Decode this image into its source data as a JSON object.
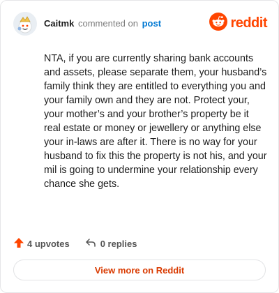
{
  "header": {
    "author": "Caitmk",
    "commented_text": "commented on",
    "post_link": "post",
    "brand": "reddit",
    "brand_color": "#ff4500",
    "link_color": "#0079d3"
  },
  "comment": {
    "body": "NTA, if you are currently sharing bank accounts and assets, please separate them, your husband’s family think they are entitled to everything you and your family own and they are not. Protect your, your mother’s and your brother’s property be it real estate or money or jewellery or anything else your in-laws are after it. There is no way for your husband to fix this the property is not his, and your mil is going to undermine your relationship every chance she gets."
  },
  "footer": {
    "upvotes": "4 upvotes",
    "replies": "0 replies"
  },
  "actions": {
    "view_more": "View more on Reddit"
  },
  "icons": {
    "avatar": "snoo-avatar-icon",
    "brand": "reddit-snoo-icon",
    "upvote": "upvote-arrow-icon",
    "reply": "reply-arrow-icon"
  }
}
